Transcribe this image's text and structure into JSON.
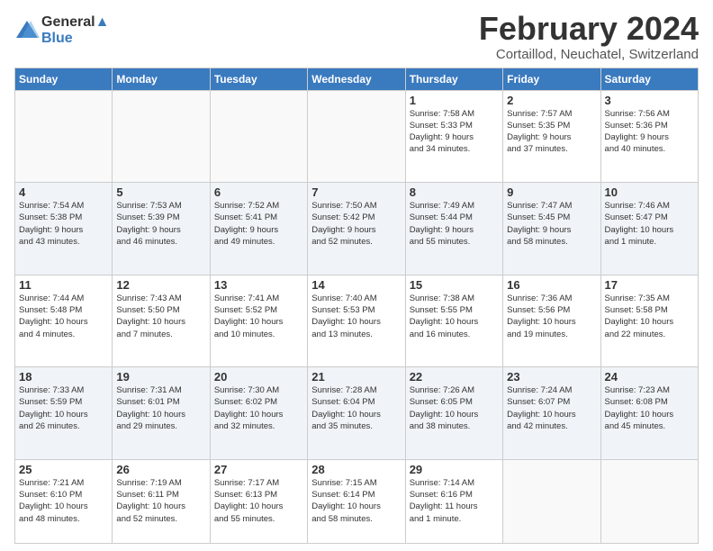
{
  "header": {
    "logo_line1": "General",
    "logo_line2": "Blue",
    "month_title": "February 2024",
    "location": "Cortaillod, Neuchatel, Switzerland"
  },
  "days_of_week": [
    "Sunday",
    "Monday",
    "Tuesday",
    "Wednesday",
    "Thursday",
    "Friday",
    "Saturday"
  ],
  "weeks": [
    [
      {
        "day": "",
        "info": ""
      },
      {
        "day": "",
        "info": ""
      },
      {
        "day": "",
        "info": ""
      },
      {
        "day": "",
        "info": ""
      },
      {
        "day": "1",
        "info": "Sunrise: 7:58 AM\nSunset: 5:33 PM\nDaylight: 9 hours\nand 34 minutes."
      },
      {
        "day": "2",
        "info": "Sunrise: 7:57 AM\nSunset: 5:35 PM\nDaylight: 9 hours\nand 37 minutes."
      },
      {
        "day": "3",
        "info": "Sunrise: 7:56 AM\nSunset: 5:36 PM\nDaylight: 9 hours\nand 40 minutes."
      }
    ],
    [
      {
        "day": "4",
        "info": "Sunrise: 7:54 AM\nSunset: 5:38 PM\nDaylight: 9 hours\nand 43 minutes."
      },
      {
        "day": "5",
        "info": "Sunrise: 7:53 AM\nSunset: 5:39 PM\nDaylight: 9 hours\nand 46 minutes."
      },
      {
        "day": "6",
        "info": "Sunrise: 7:52 AM\nSunset: 5:41 PM\nDaylight: 9 hours\nand 49 minutes."
      },
      {
        "day": "7",
        "info": "Sunrise: 7:50 AM\nSunset: 5:42 PM\nDaylight: 9 hours\nand 52 minutes."
      },
      {
        "day": "8",
        "info": "Sunrise: 7:49 AM\nSunset: 5:44 PM\nDaylight: 9 hours\nand 55 minutes."
      },
      {
        "day": "9",
        "info": "Sunrise: 7:47 AM\nSunset: 5:45 PM\nDaylight: 9 hours\nand 58 minutes."
      },
      {
        "day": "10",
        "info": "Sunrise: 7:46 AM\nSunset: 5:47 PM\nDaylight: 10 hours\nand 1 minute."
      }
    ],
    [
      {
        "day": "11",
        "info": "Sunrise: 7:44 AM\nSunset: 5:48 PM\nDaylight: 10 hours\nand 4 minutes."
      },
      {
        "day": "12",
        "info": "Sunrise: 7:43 AM\nSunset: 5:50 PM\nDaylight: 10 hours\nand 7 minutes."
      },
      {
        "day": "13",
        "info": "Sunrise: 7:41 AM\nSunset: 5:52 PM\nDaylight: 10 hours\nand 10 minutes."
      },
      {
        "day": "14",
        "info": "Sunrise: 7:40 AM\nSunset: 5:53 PM\nDaylight: 10 hours\nand 13 minutes."
      },
      {
        "day": "15",
        "info": "Sunrise: 7:38 AM\nSunset: 5:55 PM\nDaylight: 10 hours\nand 16 minutes."
      },
      {
        "day": "16",
        "info": "Sunrise: 7:36 AM\nSunset: 5:56 PM\nDaylight: 10 hours\nand 19 minutes."
      },
      {
        "day": "17",
        "info": "Sunrise: 7:35 AM\nSunset: 5:58 PM\nDaylight: 10 hours\nand 22 minutes."
      }
    ],
    [
      {
        "day": "18",
        "info": "Sunrise: 7:33 AM\nSunset: 5:59 PM\nDaylight: 10 hours\nand 26 minutes."
      },
      {
        "day": "19",
        "info": "Sunrise: 7:31 AM\nSunset: 6:01 PM\nDaylight: 10 hours\nand 29 minutes."
      },
      {
        "day": "20",
        "info": "Sunrise: 7:30 AM\nSunset: 6:02 PM\nDaylight: 10 hours\nand 32 minutes."
      },
      {
        "day": "21",
        "info": "Sunrise: 7:28 AM\nSunset: 6:04 PM\nDaylight: 10 hours\nand 35 minutes."
      },
      {
        "day": "22",
        "info": "Sunrise: 7:26 AM\nSunset: 6:05 PM\nDaylight: 10 hours\nand 38 minutes."
      },
      {
        "day": "23",
        "info": "Sunrise: 7:24 AM\nSunset: 6:07 PM\nDaylight: 10 hours\nand 42 minutes."
      },
      {
        "day": "24",
        "info": "Sunrise: 7:23 AM\nSunset: 6:08 PM\nDaylight: 10 hours\nand 45 minutes."
      }
    ],
    [
      {
        "day": "25",
        "info": "Sunrise: 7:21 AM\nSunset: 6:10 PM\nDaylight: 10 hours\nand 48 minutes."
      },
      {
        "day": "26",
        "info": "Sunrise: 7:19 AM\nSunset: 6:11 PM\nDaylight: 10 hours\nand 52 minutes."
      },
      {
        "day": "27",
        "info": "Sunrise: 7:17 AM\nSunset: 6:13 PM\nDaylight: 10 hours\nand 55 minutes."
      },
      {
        "day": "28",
        "info": "Sunrise: 7:15 AM\nSunset: 6:14 PM\nDaylight: 10 hours\nand 58 minutes."
      },
      {
        "day": "29",
        "info": "Sunrise: 7:14 AM\nSunset: 6:16 PM\nDaylight: 11 hours\nand 1 minute."
      },
      {
        "day": "",
        "info": ""
      },
      {
        "day": "",
        "info": ""
      }
    ]
  ]
}
